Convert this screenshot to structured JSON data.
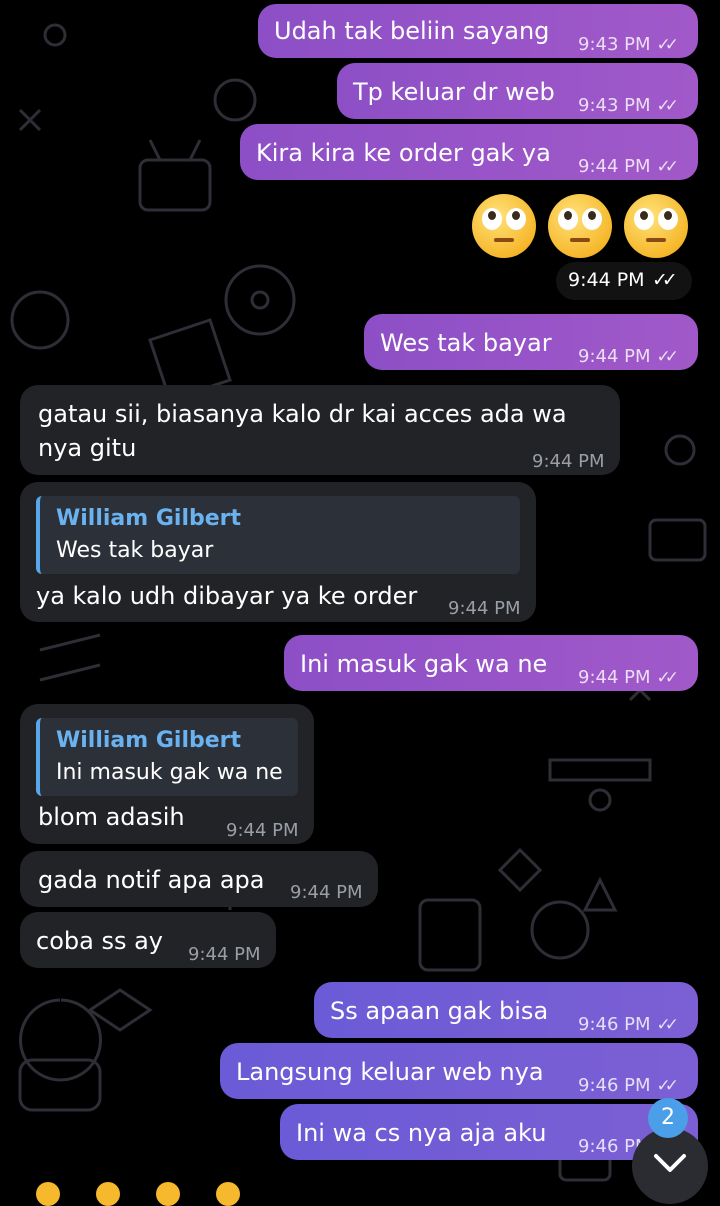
{
  "messages": [
    {
      "text": "Udah tak beliin sayang",
      "time": "9:43 PM"
    },
    {
      "text": "Tp keluar dr web",
      "time": "9:43 PM"
    },
    {
      "text": "Kira kira ke order gak ya",
      "time": "9:44 PM"
    },
    {
      "emoji": "🙄🙄🙄",
      "time": "9:44 PM"
    },
    {
      "text": "Wes tak bayar",
      "time": "9:44 PM"
    },
    {
      "line1": "gatau sii, biasanya kalo dr kai acces ada wa",
      "line2": "nya gitu",
      "time": "9:44 PM"
    },
    {
      "reply_name": "William Gilbert",
      "reply_text": "Wes tak bayar",
      "text": "ya kalo udh dibayar ya ke order",
      "time": "9:44 PM"
    },
    {
      "text": "Ini masuk gak wa ne",
      "time": "9:44 PM"
    },
    {
      "reply_name": "William Gilbert",
      "reply_text": "Ini masuk gak wa ne",
      "text": "blom adasih",
      "time": "9:44 PM"
    },
    {
      "text": "gada notif apa apa",
      "time": "9:44 PM"
    },
    {
      "text": "coba ss ay",
      "time": "9:44 PM"
    },
    {
      "text": "Ss apaan gak bisa",
      "time": "9:46 PM"
    },
    {
      "text": "Langsung keluar web nya",
      "time": "9:46 PM"
    },
    {
      "text": "Ini wa cs nya aja aku",
      "time": "9:46 PM"
    }
  ],
  "read_ticks": "✓✓",
  "unread_badge": "2",
  "scroll_down_icon": "chevron-down-icon",
  "wallpaper_theme": "game-doodles",
  "colors": {
    "outgoing_bubble": "#a159c9",
    "outgoing_bubble_late": "#7c5fd4",
    "incoming_bubble": "#222326",
    "reply_name": "#6ab2f0",
    "badge": "#4a9fe8"
  }
}
